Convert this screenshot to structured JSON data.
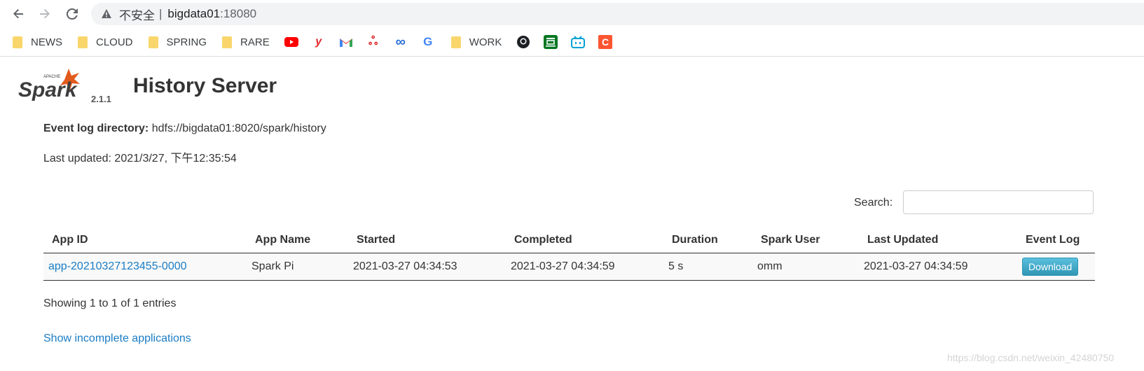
{
  "browser": {
    "back_icon": "arrow-left-icon",
    "forward_icon": "arrow-right-icon",
    "reload_icon": "reload-icon",
    "security_label": "不安全",
    "url_host": "bigdata01",
    "url_port": ":18080",
    "bookmarks": [
      {
        "type": "folder",
        "label": "NEWS"
      },
      {
        "type": "folder",
        "label": "CLOUD"
      },
      {
        "type": "folder",
        "label": "SPRING"
      },
      {
        "type": "folder",
        "label": "RARE"
      },
      {
        "type": "icon",
        "name": "youtube-icon"
      },
      {
        "type": "icon",
        "name": "y-icon"
      },
      {
        "type": "icon",
        "name": "gmail-icon"
      },
      {
        "type": "icon",
        "name": "red-app-icon"
      },
      {
        "type": "icon",
        "name": "infinity-icon"
      },
      {
        "type": "icon",
        "name": "google-icon"
      },
      {
        "type": "folder",
        "label": "WORK"
      },
      {
        "type": "icon",
        "name": "github-icon"
      },
      {
        "type": "icon",
        "name": "douban-icon"
      },
      {
        "type": "icon",
        "name": "bilibili-icon"
      },
      {
        "type": "icon",
        "name": "csdn-icon"
      }
    ]
  },
  "page": {
    "logo_icon": "spark-logo",
    "logo_small": "APACHE",
    "logo_word": "Spark",
    "version": "2.1.1",
    "title": "History Server",
    "event_log_label": "Event log directory:",
    "event_log_value": "hdfs://bigdata01:8020/spark/history",
    "last_updated_text": "Last updated: 2021/3/27, 下午12:35:54",
    "search_label": "Search:",
    "search_value": "",
    "showing": "Showing 1 to 1 of 1 entries",
    "incomplete_link": "Show incomplete applications",
    "watermark": "https://blog.csdn.net/weixin_42480750"
  },
  "table": {
    "headers": [
      "App ID",
      "App Name",
      "Started",
      "Completed",
      "Duration",
      "Spark User",
      "Last Updated",
      "Event Log"
    ],
    "rows": [
      {
        "app_id": "app-20210327123455-0000",
        "app_name": "Spark Pi",
        "started": "2021-03-27 04:34:53",
        "completed": "2021-03-27 04:34:59",
        "duration": "5 s",
        "spark_user": "omm",
        "last_updated": "2021-03-27 04:34:59",
        "event_log": "Download"
      }
    ]
  },
  "colors": {
    "link": "#1a7dc4",
    "download_button": "#2f96b4",
    "spark_orange": "#e25a1c"
  }
}
